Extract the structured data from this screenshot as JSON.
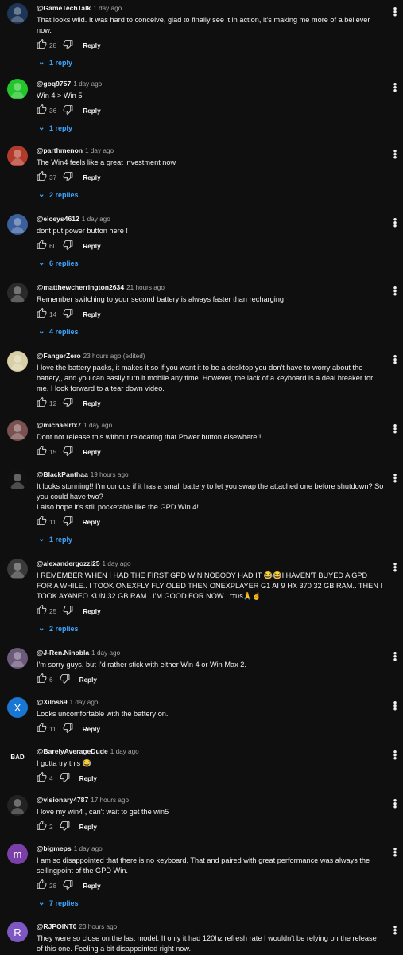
{
  "comments": [
    {
      "author": "@GameTechTalk",
      "time": "1 day ago",
      "text": "That looks wild. It was hard to conceive, glad to finally see it in action, it's making me more of a believer now.",
      "likes": "28",
      "reply_label": "Reply",
      "replies": "1 reply",
      "avatar_letter": "",
      "avatar_color": "#1d3557"
    },
    {
      "author": "@goq9757",
      "time": "1 day ago",
      "text": "Win 4 > Win 5",
      "likes": "36",
      "reply_label": "Reply",
      "replies": "1 reply",
      "avatar_letter": "",
      "avatar_color": "#22c52a"
    },
    {
      "author": "@parthmenon",
      "time": "1 day ago",
      "text": "The Win4 feels like a great investment now",
      "likes": "37",
      "reply_label": "Reply",
      "replies": "2 replies",
      "avatar_letter": "",
      "avatar_color": "#b23a2a"
    },
    {
      "author": "@eiceys4612",
      "time": "1 day ago",
      "text": "dont put power button here !",
      "likes": "60",
      "reply_label": "Reply",
      "replies": "6 replies",
      "avatar_letter": "",
      "avatar_color": "#3b5f9c"
    },
    {
      "author": "@matthewcherrington2634",
      "time": "21 hours ago",
      "text": "Remember switching to your second battery is always faster than recharging",
      "likes": "14",
      "reply_label": "Reply",
      "replies": "4 replies",
      "avatar_letter": "",
      "avatar_color": "#2a2a2a"
    },
    {
      "author": "@FangerZero",
      "time": "23 hours ago (edited)",
      "text": "I love the battery packs, it makes it so if you want it to be a desktop you don't have to worry about the battery,, and you can easily turn it mobile any time. However, the lack of a keyboard is a deal breaker for me. I look forward to a tear down video.",
      "likes": "12",
      "reply_label": "Reply",
      "replies": "",
      "avatar_letter": "",
      "avatar_color": "#d8cfa6"
    },
    {
      "author": "@michaelrfx7",
      "time": "1 day ago",
      "text": "Dont not release this without relocating that Power button elsewhere!!",
      "likes": "15",
      "reply_label": "Reply",
      "replies": "",
      "avatar_letter": "",
      "avatar_color": "#7a5050"
    },
    {
      "author": "@BlackPanthaa",
      "time": "19 hours ago",
      "text": "It looks stunning!! I'm curious if it has a small battery to let you swap the attached one before shutdown? So you could have two?\nI also hope it's still pocketable like the GPD Win 4!",
      "likes": "11",
      "reply_label": "Reply",
      "replies": "1 reply",
      "avatar_letter": "",
      "avatar_color": "#111111"
    },
    {
      "author": "@alexandergozzi25",
      "time": "1 day ago",
      "text": "I REMEMBER WHEN I HAD THE FIRST GPD WIN NOBODY HAD IT 😂😂I HAVEN'T BUYED A GPD FOR A WHILE.. I TOOK ONEXFLY FLY OLED THEN ONEXPLAYER G1 AI 9 HX 370 32 GB RAM.. THEN I TOOK AYANEO KUN 32 GB RAM.. I'M GOOD FOR NOW.. ɪᴛᴜs🙏☝",
      "likes": "25",
      "reply_label": "Reply",
      "replies": "2 replies",
      "avatar_letter": "",
      "avatar_color": "#3a3a3a"
    },
    {
      "author": "@J-Ren.Ninobla",
      "time": "1 day ago",
      "text": "I'm sorry guys, but I'd rather stick with either Win 4 or Win Max 2.",
      "likes": "6",
      "reply_label": "Reply",
      "replies": "",
      "avatar_letter": "",
      "avatar_color": "#6b5a7a"
    },
    {
      "author": "@Xilos69",
      "time": "1 day ago",
      "text": "Looks uncomfortable with the battery on.",
      "likes": "11",
      "reply_label": "Reply",
      "replies": "",
      "avatar_letter": "X",
      "avatar_color": "#1976d2"
    },
    {
      "author": "@BarelyAverageDude",
      "time": "1 day ago",
      "text": "I gotta try this  😂",
      "likes": "4",
      "reply_label": "Reply",
      "replies": "",
      "avatar_letter": "BAD",
      "avatar_color": "#0f0f0f"
    },
    {
      "author": "@visionary4787",
      "time": "17 hours ago",
      "text": "I love my win4 , can't wait to get the win5",
      "likes": "2",
      "reply_label": "Reply",
      "replies": "",
      "avatar_letter": "",
      "avatar_color": "#222222"
    },
    {
      "author": "@bigmeps",
      "time": "1 day ago",
      "text": "I am so disappointed that there is no keyboard. That and paired with great performance was always the sellingpoint of the GPD Win.",
      "likes": "28",
      "reply_label": "Reply",
      "replies": "7 replies",
      "avatar_letter": "m",
      "avatar_color": "#7b3fa8"
    },
    {
      "author": "@RJPOINT0",
      "time": "23 hours ago",
      "text": "They were so close on the last model. If only it had 120hz refresh rate I wouldn't be relying on the release of this one. Feeling a bit disappointed right now.",
      "likes": "",
      "reply_label": "",
      "replies": "",
      "avatar_letter": "R",
      "avatar_color": "#7e57c2"
    }
  ]
}
